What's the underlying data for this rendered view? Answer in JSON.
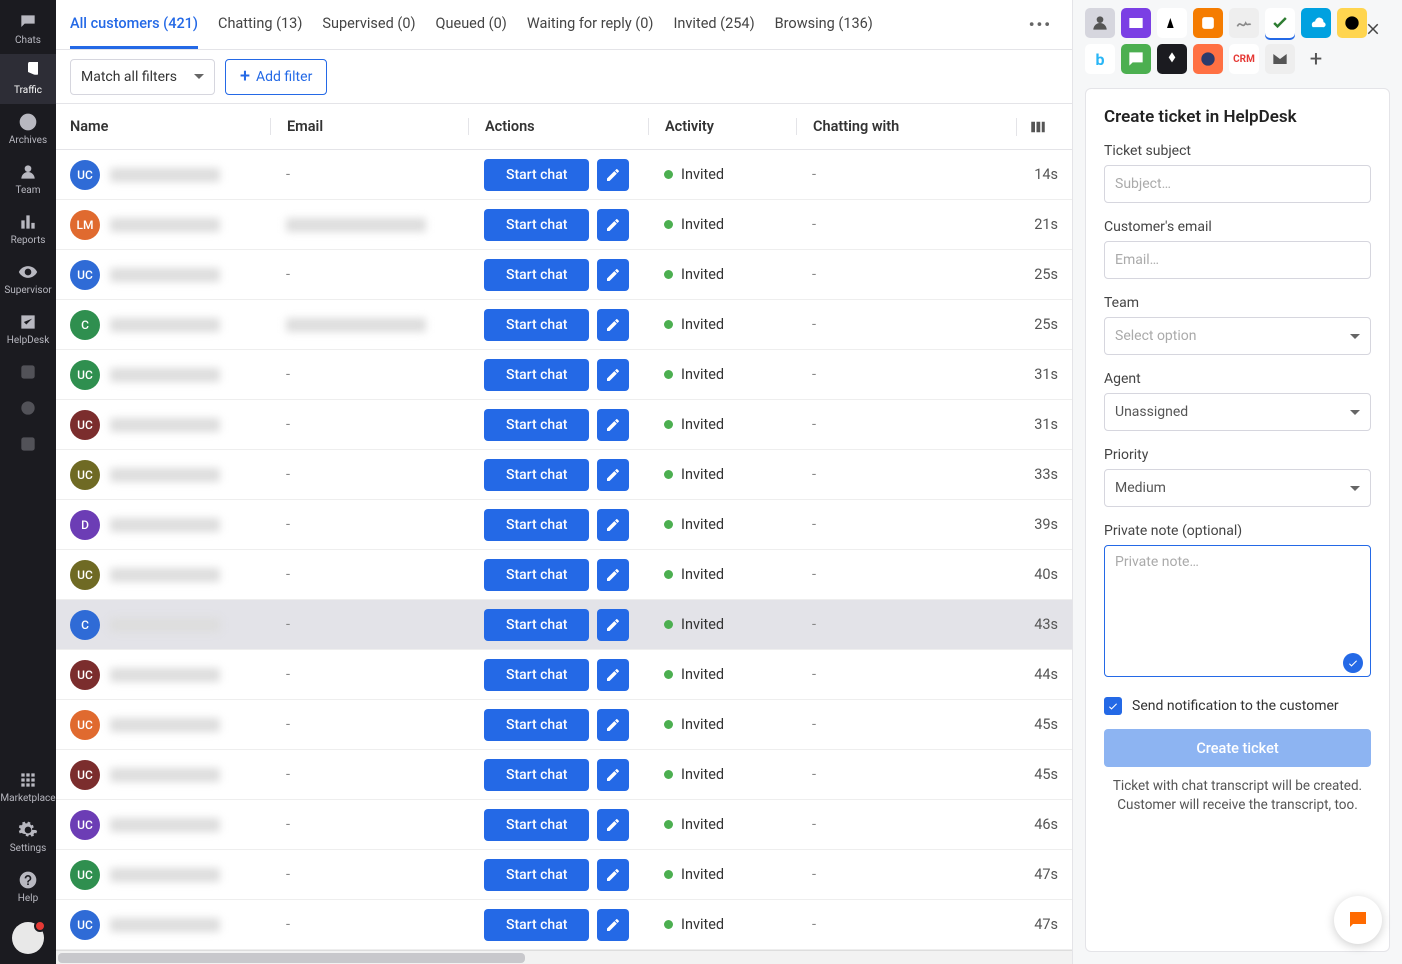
{
  "nav": {
    "items": [
      {
        "label": "Chats",
        "icon": "chat"
      },
      {
        "label": "Traffic",
        "icon": "radar"
      },
      {
        "label": "Archives",
        "icon": "clock"
      },
      {
        "label": "Team",
        "icon": "team"
      },
      {
        "label": "Reports",
        "icon": "bar"
      },
      {
        "label": "Supervisor",
        "icon": "eye"
      },
      {
        "label": "HelpDesk",
        "icon": "check"
      }
    ],
    "bottom": [
      {
        "label": "Marketplace",
        "icon": "grid"
      },
      {
        "label": "Settings",
        "icon": "gear"
      },
      {
        "label": "Help",
        "icon": "help"
      }
    ]
  },
  "tabs": [
    {
      "label": "All customers (421)",
      "active": true
    },
    {
      "label": "Chatting (13)"
    },
    {
      "label": "Supervised (0)"
    },
    {
      "label": "Queued (0)"
    },
    {
      "label": "Waiting for reply (0)"
    },
    {
      "label": "Invited (254)"
    },
    {
      "label": "Browsing (136)"
    }
  ],
  "filters": {
    "match": "Match all filters",
    "add": "Add filter"
  },
  "columns": {
    "name": "Name",
    "email": "Email",
    "actions": "Actions",
    "activity": "Activity",
    "chatting": "Chatting with"
  },
  "start_chat_label": "Start chat",
  "activity_label": "Invited",
  "dash": "-",
  "rows": [
    {
      "initials": "UC",
      "color": "#2f6bd6",
      "email_blur": false,
      "time": "14s"
    },
    {
      "initials": "LM",
      "color": "#e06a2f",
      "email_blur": true,
      "time": "21s"
    },
    {
      "initials": "UC",
      "color": "#2f6bd6",
      "email_blur": false,
      "time": "25s"
    },
    {
      "initials": "C",
      "color": "#2f8f4f",
      "email_blur": true,
      "time": "25s"
    },
    {
      "initials": "UC",
      "color": "#2f8f4f",
      "email_blur": false,
      "time": "31s"
    },
    {
      "initials": "UC",
      "color": "#7b2d2d",
      "email_blur": false,
      "time": "31s"
    },
    {
      "initials": "UC",
      "color": "#6f6a24",
      "email_blur": false,
      "time": "33s"
    },
    {
      "initials": "D",
      "color": "#6c3db5",
      "email_blur": false,
      "time": "39s"
    },
    {
      "initials": "UC",
      "color": "#6f6a24",
      "email_blur": false,
      "time": "40s"
    },
    {
      "initials": "C",
      "color": "#2f6bd6",
      "email_blur": false,
      "time": "43s",
      "selected": true
    },
    {
      "initials": "UC",
      "color": "#7b2d2d",
      "email_blur": false,
      "time": "44s"
    },
    {
      "initials": "UC",
      "color": "#e06a2f",
      "email_blur": false,
      "time": "45s"
    },
    {
      "initials": "UC",
      "color": "#7b2d2d",
      "email_blur": false,
      "time": "45s"
    },
    {
      "initials": "UC",
      "color": "#6c3db5",
      "email_blur": false,
      "time": "46s"
    },
    {
      "initials": "UC",
      "color": "#2f8f4f",
      "email_blur": false,
      "time": "47s"
    },
    {
      "initials": "UC",
      "color": "#2f6bd6",
      "email_blur": false,
      "time": "47s"
    }
  ],
  "ticket": {
    "title": "Create ticket in HelpDesk",
    "subject_label": "Ticket subject",
    "subject_placeholder": "Subject…",
    "email_label": "Customer's email",
    "email_placeholder": "Email…",
    "team_label": "Team",
    "team_placeholder": "Select option",
    "agent_label": "Agent",
    "agent_value": "Unassigned",
    "priority_label": "Priority",
    "priority_value": "Medium",
    "note_label": "Private note (optional)",
    "note_placeholder": "Private note…",
    "notify_label": "Send notification to the customer",
    "create_label": "Create ticket",
    "foot": "Ticket with chat transcript will be created. Customer will receive the transcript, too."
  },
  "app_tiles": [
    {
      "name": "person",
      "bg": "#d6d6de",
      "fg": "#555"
    },
    {
      "name": "proton",
      "bg": "#7b3fe4",
      "fg": "#fff"
    },
    {
      "name": "dog",
      "bg": "#fff",
      "fg": "#000"
    },
    {
      "name": "blogger",
      "bg": "#f57c00",
      "fg": "#fff"
    },
    {
      "name": "sig",
      "bg": "#eee",
      "fg": "#888"
    },
    {
      "name": "check",
      "bg": "#fff",
      "fg": "#2e7d32",
      "selected": true
    },
    {
      "name": "sales",
      "bg": "#00a1e0",
      "fg": "#fff"
    },
    {
      "name": "mail",
      "bg": "#ffd54f",
      "fg": "#000"
    },
    {
      "name": "b",
      "bg": "#fff",
      "fg": "#29b6f6"
    },
    {
      "name": "msg",
      "bg": "#4caf50",
      "fg": "#fff"
    },
    {
      "name": "x",
      "bg": "#1b1b20",
      "fg": "#fff"
    },
    {
      "name": "circle",
      "bg": "#ff7043",
      "fg": "#2b3a6b"
    },
    {
      "name": "crm",
      "bg": "#fff",
      "fg": "#e53935"
    },
    {
      "name": "envelope",
      "bg": "#eee",
      "fg": "#555"
    }
  ]
}
